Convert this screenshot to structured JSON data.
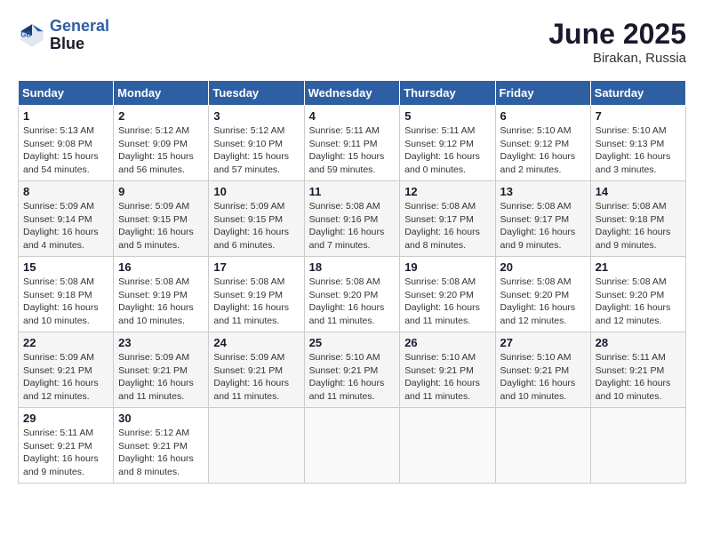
{
  "header": {
    "logo_line1": "General",
    "logo_line2": "Blue",
    "month": "June 2025",
    "location": "Birakan, Russia"
  },
  "weekdays": [
    "Sunday",
    "Monday",
    "Tuesday",
    "Wednesday",
    "Thursday",
    "Friday",
    "Saturday"
  ],
  "weeks": [
    [
      {
        "day": "1",
        "info": "Sunrise: 5:13 AM\nSunset: 9:08 PM\nDaylight: 15 hours\nand 54 minutes."
      },
      {
        "day": "2",
        "info": "Sunrise: 5:12 AM\nSunset: 9:09 PM\nDaylight: 15 hours\nand 56 minutes."
      },
      {
        "day": "3",
        "info": "Sunrise: 5:12 AM\nSunset: 9:10 PM\nDaylight: 15 hours\nand 57 minutes."
      },
      {
        "day": "4",
        "info": "Sunrise: 5:11 AM\nSunset: 9:11 PM\nDaylight: 15 hours\nand 59 minutes."
      },
      {
        "day": "5",
        "info": "Sunrise: 5:11 AM\nSunset: 9:12 PM\nDaylight: 16 hours\nand 0 minutes."
      },
      {
        "day": "6",
        "info": "Sunrise: 5:10 AM\nSunset: 9:12 PM\nDaylight: 16 hours\nand 2 minutes."
      },
      {
        "day": "7",
        "info": "Sunrise: 5:10 AM\nSunset: 9:13 PM\nDaylight: 16 hours\nand 3 minutes."
      }
    ],
    [
      {
        "day": "8",
        "info": "Sunrise: 5:09 AM\nSunset: 9:14 PM\nDaylight: 16 hours\nand 4 minutes."
      },
      {
        "day": "9",
        "info": "Sunrise: 5:09 AM\nSunset: 9:15 PM\nDaylight: 16 hours\nand 5 minutes."
      },
      {
        "day": "10",
        "info": "Sunrise: 5:09 AM\nSunset: 9:15 PM\nDaylight: 16 hours\nand 6 minutes."
      },
      {
        "day": "11",
        "info": "Sunrise: 5:08 AM\nSunset: 9:16 PM\nDaylight: 16 hours\nand 7 minutes."
      },
      {
        "day": "12",
        "info": "Sunrise: 5:08 AM\nSunset: 9:17 PM\nDaylight: 16 hours\nand 8 minutes."
      },
      {
        "day": "13",
        "info": "Sunrise: 5:08 AM\nSunset: 9:17 PM\nDaylight: 16 hours\nand 9 minutes."
      },
      {
        "day": "14",
        "info": "Sunrise: 5:08 AM\nSunset: 9:18 PM\nDaylight: 16 hours\nand 9 minutes."
      }
    ],
    [
      {
        "day": "15",
        "info": "Sunrise: 5:08 AM\nSunset: 9:18 PM\nDaylight: 16 hours\nand 10 minutes."
      },
      {
        "day": "16",
        "info": "Sunrise: 5:08 AM\nSunset: 9:19 PM\nDaylight: 16 hours\nand 10 minutes."
      },
      {
        "day": "17",
        "info": "Sunrise: 5:08 AM\nSunset: 9:19 PM\nDaylight: 16 hours\nand 11 minutes."
      },
      {
        "day": "18",
        "info": "Sunrise: 5:08 AM\nSunset: 9:20 PM\nDaylight: 16 hours\nand 11 minutes."
      },
      {
        "day": "19",
        "info": "Sunrise: 5:08 AM\nSunset: 9:20 PM\nDaylight: 16 hours\nand 11 minutes."
      },
      {
        "day": "20",
        "info": "Sunrise: 5:08 AM\nSunset: 9:20 PM\nDaylight: 16 hours\nand 12 minutes."
      },
      {
        "day": "21",
        "info": "Sunrise: 5:08 AM\nSunset: 9:20 PM\nDaylight: 16 hours\nand 12 minutes."
      }
    ],
    [
      {
        "day": "22",
        "info": "Sunrise: 5:09 AM\nSunset: 9:21 PM\nDaylight: 16 hours\nand 12 minutes."
      },
      {
        "day": "23",
        "info": "Sunrise: 5:09 AM\nSunset: 9:21 PM\nDaylight: 16 hours\nand 11 minutes."
      },
      {
        "day": "24",
        "info": "Sunrise: 5:09 AM\nSunset: 9:21 PM\nDaylight: 16 hours\nand 11 minutes."
      },
      {
        "day": "25",
        "info": "Sunrise: 5:10 AM\nSunset: 9:21 PM\nDaylight: 16 hours\nand 11 minutes."
      },
      {
        "day": "26",
        "info": "Sunrise: 5:10 AM\nSunset: 9:21 PM\nDaylight: 16 hours\nand 11 minutes."
      },
      {
        "day": "27",
        "info": "Sunrise: 5:10 AM\nSunset: 9:21 PM\nDaylight: 16 hours\nand 10 minutes."
      },
      {
        "day": "28",
        "info": "Sunrise: 5:11 AM\nSunset: 9:21 PM\nDaylight: 16 hours\nand 10 minutes."
      }
    ],
    [
      {
        "day": "29",
        "info": "Sunrise: 5:11 AM\nSunset: 9:21 PM\nDaylight: 16 hours\nand 9 minutes."
      },
      {
        "day": "30",
        "info": "Sunrise: 5:12 AM\nSunset: 9:21 PM\nDaylight: 16 hours\nand 8 minutes."
      },
      {
        "day": "",
        "info": ""
      },
      {
        "day": "",
        "info": ""
      },
      {
        "day": "",
        "info": ""
      },
      {
        "day": "",
        "info": ""
      },
      {
        "day": "",
        "info": ""
      }
    ]
  ]
}
